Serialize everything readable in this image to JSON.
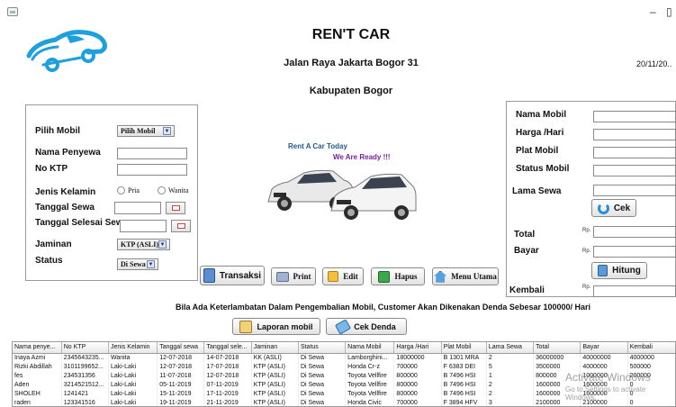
{
  "window": {
    "minimize": "–",
    "maximize": "▯"
  },
  "header": {
    "title": "REN'T CAR",
    "address_line1": "Jalan Raya Jakarta Bogor 31",
    "address_line2": "Kabupaten Bogor",
    "date": "20/11/20.."
  },
  "colors": {
    "logo_blue": "#1ea0dc",
    "ad_blue": "#1f5a8c",
    "ad_purple": "#7a1fa0"
  },
  "left_form": {
    "pilih_mobil_label": "Pilih Mobil",
    "pilih_mobil_value": "Pilih Mobil",
    "nama_penyewa_label": "Nama Penyewa",
    "no_ktp_label": "No KTP",
    "jenis_kelamin_label": "Jenis Kelamin",
    "gender_pria": "Pria",
    "gender_wanita": "Wanita",
    "tanggal_sewa_label": "Tanggal Sewa",
    "tanggal_selesai_label": "Tanggal Selesai Sewa",
    "jaminan_label": "Jaminan",
    "jaminan_value": "KTP (ASLI)",
    "status_label": "Status",
    "status_value": "Di Sewa"
  },
  "ad": {
    "line1": "Rent A Car Today",
    "line2": "We Are Ready !!!"
  },
  "right_form": {
    "nama_mobil_label": "Nama Mobil",
    "harga_label": "Harga /Hari",
    "plat_label": "Plat Mobil",
    "status_mobil_label": "Status Mobil",
    "lama_sewa_label": "Lama Sewa",
    "cek_button": "Cek",
    "total_label": "Total",
    "bayar_label": "Bayar",
    "rp": "Rp.",
    "hitung_button": "Hitung",
    "kembali_label": "Kembali"
  },
  "actions": {
    "transaksi": "Transaksi",
    "print": "Print",
    "edit": "Edit",
    "hapus": "Hapus",
    "menu_utama": "Menu Utama",
    "laporan": "Laporan mobil",
    "cek_denda": "Cek Denda"
  },
  "notice": "Bila Ada Keterlambatan Dalam Pengembalian Mobil, Customer Akan Dikenakan Denda Sebesar  100000/ Hari",
  "table": {
    "columns": [
      "Nama penye...",
      "No KTP",
      "Jenis Kelamin",
      "Tanggal sewa",
      "Tanggal sele...",
      "Jaminan",
      "Status",
      "Nama Mobil",
      "Harga /Hari",
      "Plat Mobil",
      "Lama Sewa",
      "Total",
      "Bayar",
      "Kembali"
    ],
    "rows": [
      [
        "Inaya Azmi",
        "2345643235...",
        "Wanita",
        "12-07-2018",
        "14-07-2018",
        "KK (ASLI)",
        "Di Sewa",
        "Lamborghini...",
        "18000000",
        "B 1301 MRA",
        "2",
        "36000000",
        "40000000",
        "4000000"
      ],
      [
        "Rizki Abdillah",
        "3101199652...",
        "Laki-Laki",
        "12-07-2018",
        "17-07-2018",
        "KTP (ASLI)",
        "Di Sewa",
        "Honda Cr-z",
        "700000",
        "F 6383 DEI",
        "5",
        "3500000",
        "4000000",
        "500000"
      ],
      [
        "fes",
        "234531356",
        "Laki-Laki",
        "11-07-2018",
        "12-07-2018",
        "KTP (ASLI)",
        "Di Sewa",
        "Toyota Vellfire",
        "800000",
        "B 7496 HSI",
        "1",
        "800000",
        "1000000",
        "200000"
      ],
      [
        "Aden",
        "3214521512...",
        "Laki-Laki",
        "05-11-2019",
        "07-11-2019",
        "KTP (ASLI)",
        "Di Sewa",
        "Toyota Vellfire",
        "800000",
        "B 7496 HSI",
        "2",
        "1600000",
        "1600000",
        "0"
      ],
      [
        "SHOLEH",
        "1241421",
        "Laki-Laki",
        "15-11-2019",
        "17-11-2019",
        "KTP (ASLI)",
        "Di Sewa",
        "Toyota Vellfire",
        "800000",
        "B 7496 HSI",
        "2",
        "1600000",
        "1600000",
        "0"
      ],
      [
        "raden",
        "123341516",
        "Laki-Laki",
        "19-11-2019",
        "21-11-2019",
        "KTP (ASLI)",
        "Di Sewa",
        "Honda Civic",
        "700000",
        "F 3894 HFV",
        "3",
        "2100000",
        "2100000",
        "0"
      ]
    ]
  },
  "watermark": {
    "line1": "Activate Windows",
    "line2": "Go to Settings to activate Windows."
  }
}
